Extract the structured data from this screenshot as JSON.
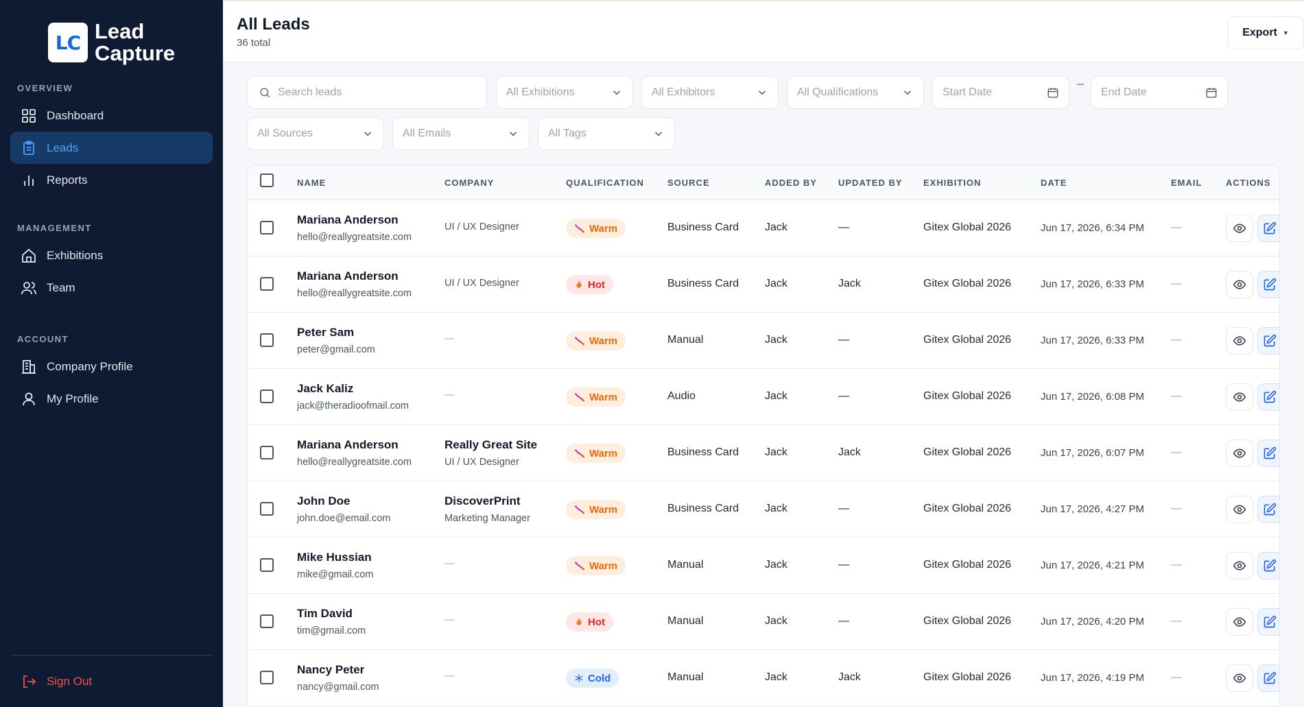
{
  "brand": {
    "logo_text": "LC",
    "line1": "Lead",
    "line2": "Capture"
  },
  "sidebar": {
    "sections": [
      {
        "heading": "OVERVIEW",
        "items": [
          {
            "label": "Dashboard",
            "icon": "grid-icon"
          },
          {
            "label": "Leads",
            "icon": "clipboard-icon",
            "active": true
          },
          {
            "label": "Reports",
            "icon": "bar-chart-icon"
          }
        ]
      },
      {
        "heading": "MANAGEMENT",
        "items": [
          {
            "label": "Exhibitions",
            "icon": "home-icon"
          },
          {
            "label": "Team",
            "icon": "users-icon"
          }
        ]
      },
      {
        "heading": "ACCOUNT",
        "items": [
          {
            "label": "Company Profile",
            "icon": "building-icon"
          },
          {
            "label": "My Profile",
            "icon": "user-icon"
          }
        ]
      }
    ],
    "signout": "Sign Out"
  },
  "header": {
    "title": "All Leads",
    "subtitle": "36 total",
    "export_label": "Export"
  },
  "filters": {
    "search_placeholder": "Search leads",
    "exhibitions": "All Exhibitions",
    "exhibitors": "All Exhibitors",
    "qualifications": "All Qualifications",
    "start_date": "Start Date",
    "end_date": "End Date",
    "sources": "All Sources",
    "emails": "All Emails",
    "tags": "All Tags"
  },
  "table": {
    "columns": [
      "NAME",
      "COMPANY",
      "QUALIFICATION",
      "SOURCE",
      "ADDED BY",
      "UPDATED BY",
      "EXHIBITION",
      "DATE",
      "EMAIL",
      "ACTIONS"
    ],
    "rows": [
      {
        "name": "Mariana Anderson",
        "email": "hello@reallygreatsite.com",
        "company": "",
        "company_sub": "UI / UX Designer",
        "qualification": "Warm",
        "source": "Business Card",
        "added_by": "Jack",
        "updated_by": "—",
        "exhibition": "Gitex Global 2026",
        "date": "Jun 17, 2026, 6:34 PM",
        "email_status": "—"
      },
      {
        "name": "Mariana Anderson",
        "email": "hello@reallygreatsite.com",
        "company": "",
        "company_sub": "UI / UX Designer",
        "qualification": "Hot",
        "source": "Business Card",
        "added_by": "Jack",
        "updated_by": "Jack",
        "exhibition": "Gitex Global 2026",
        "date": "Jun 17, 2026, 6:33 PM",
        "email_status": "—"
      },
      {
        "name": "Peter Sam",
        "email": "peter@gmail.com",
        "company": "",
        "company_sub": "—",
        "qualification": "Warm",
        "source": "Manual",
        "added_by": "Jack",
        "updated_by": "—",
        "exhibition": "Gitex Global 2026",
        "date": "Jun 17, 2026, 6:33 PM",
        "email_status": "—"
      },
      {
        "name": "Jack Kaliz",
        "email": "jack@theradioofmail.com",
        "company": "",
        "company_sub": "—",
        "qualification": "Warm",
        "source": "Audio",
        "added_by": "Jack",
        "updated_by": "—",
        "exhibition": "Gitex Global 2026",
        "date": "Jun 17, 2026, 6:08 PM",
        "email_status": "—"
      },
      {
        "name": "Mariana Anderson",
        "email": "hello@reallygreatsite.com",
        "company": "Really Great Site",
        "company_sub": "UI / UX Designer",
        "qualification": "Warm",
        "source": "Business Card",
        "added_by": "Jack",
        "updated_by": "Jack",
        "exhibition": "Gitex Global 2026",
        "date": "Jun 17, 2026, 6:07 PM",
        "email_status": "—"
      },
      {
        "name": "John Doe",
        "email": "john.doe@email.com",
        "company": "DiscoverPrint",
        "company_sub": "Marketing Manager",
        "qualification": "Warm",
        "source": "Business Card",
        "added_by": "Jack",
        "updated_by": "—",
        "exhibition": "Gitex Global 2026",
        "date": "Jun 17, 2026, 4:27 PM",
        "email_status": "—"
      },
      {
        "name": "Mike Hussian",
        "email": "mike@gmail.com",
        "company": "",
        "company_sub": "—",
        "qualification": "Warm",
        "source": "Manual",
        "added_by": "Jack",
        "updated_by": "—",
        "exhibition": "Gitex Global 2026",
        "date": "Jun 17, 2026, 4:21 PM",
        "email_status": "—"
      },
      {
        "name": "Tim David",
        "email": "tim@gmail.com",
        "company": "",
        "company_sub": "—",
        "qualification": "Hot",
        "source": "Manual",
        "added_by": "Jack",
        "updated_by": "—",
        "exhibition": "Gitex Global 2026",
        "date": "Jun 17, 2026, 4:20 PM",
        "email_status": "—"
      },
      {
        "name": "Nancy Peter",
        "email": "nancy@gmail.com",
        "company": "",
        "company_sub": "—",
        "qualification": "Cold",
        "source": "Manual",
        "added_by": "Jack",
        "updated_by": "Jack",
        "exhibition": "Gitex Global 2026",
        "date": "Jun 17, 2026, 4:19 PM",
        "email_status": "—"
      }
    ]
  },
  "colors": {
    "sidebar_bg": "#0f1b33",
    "accent": "#4ea3ff",
    "warm": "#ea6a0c",
    "hot": "#dc2626",
    "cold": "#2563eb",
    "danger": "#f05252"
  }
}
